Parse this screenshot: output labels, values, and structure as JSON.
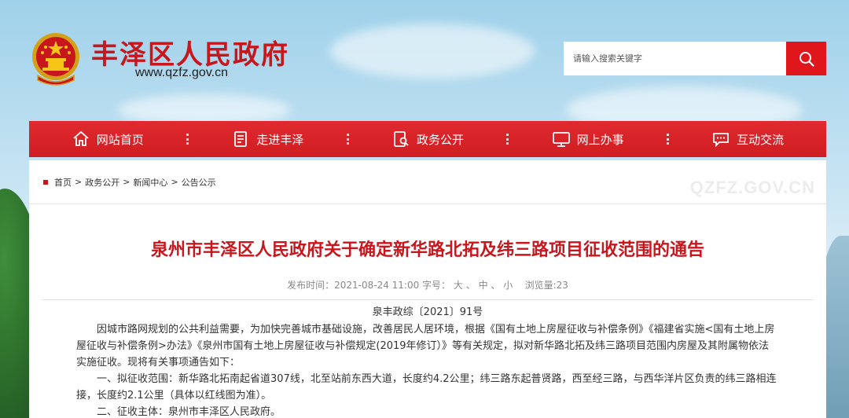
{
  "header": {
    "site_title": "丰泽区人民政府",
    "site_url": "www.qzfz.gov.cn",
    "search_placeholder": "请输入搜索关键字"
  },
  "nav": [
    {
      "label": "网站首页",
      "icon": "home-icon"
    },
    {
      "label": "走进丰泽",
      "icon": "document-icon"
    },
    {
      "label": "政务公开",
      "icon": "search-doc-icon"
    },
    {
      "label": "网上办事",
      "icon": "monitor-icon"
    },
    {
      "label": "互动交流",
      "icon": "chat-icon"
    }
  ],
  "breadcrumb": [
    "首页",
    "政务公开",
    "新闻中心",
    "公告公示"
  ],
  "watermark": "QZFZ.GOV.CN",
  "article": {
    "title": "泉州市丰泽区人民政府关于确定新华路北拓及纬三路项目征收范围的通告",
    "meta_prefix": "发布时间：2021-08-24 11:00 字号：",
    "font_sizes": [
      "大",
      "中",
      "小"
    ],
    "views": "浏览量:23",
    "doc_no": "泉丰政综〔2021〕91号",
    "paragraphs": [
      "因城市路网规划的公共利益需要，为加快完善城市基础设施，改善居民人居环境，根据《国有土地上房屋征收与补偿条例》《福建省实施<国有土地上房屋征收与补偿条例>办法》《泉州市国有土地上房屋征收与补偿规定(2019年修订）》等有关规定，拟对新华路北拓及纬三路项目范围内房屋及其附属物依法实施征收。现将有关事项通告如下：",
      "一、拟征收范围：新华路北拓南起省道307线，北至站前东西大道，长度约4.2公里；纬三路东起普贤路，西至经三路，与西华洋片区负责的纬三路相连接，长度约2.1公里（具体以红线图为准）。",
      "二、征收主体：泉州市丰泽区人民政府。"
    ]
  },
  "colors": {
    "brand_red": "#c8161d",
    "nav_red": "#d7232a",
    "search_btn": "#e0161d"
  }
}
